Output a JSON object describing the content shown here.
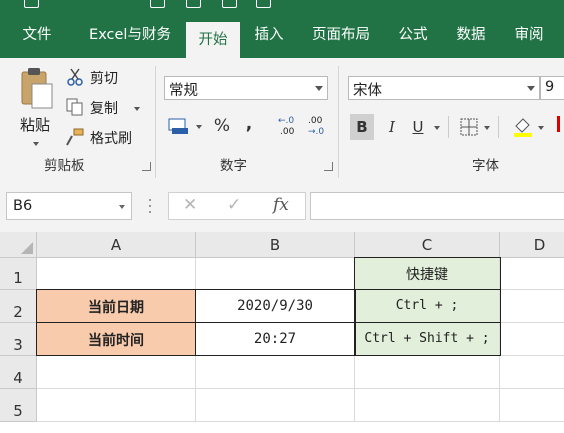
{
  "ribbon_tabs": [
    {
      "label": "文件"
    },
    {
      "label": "Excel与财务"
    },
    {
      "label": "开始"
    },
    {
      "label": "插入"
    },
    {
      "label": "页面布局"
    },
    {
      "label": "公式"
    },
    {
      "label": "数据"
    },
    {
      "label": "审阅"
    }
  ],
  "active_tab": "开始",
  "clipboard": {
    "paste_label": "粘贴",
    "cut_label": "剪切",
    "copy_label": "复制",
    "format_painter_label": "格式刷",
    "group_label": "剪贴板"
  },
  "number": {
    "format_value": "常规",
    "percent_symbol": "%",
    "comma_symbol": ",",
    "inc_decimal_top": "←.0",
    "inc_decimal_bottom": ".00",
    "dec_decimal_top": ".00",
    "dec_decimal_bottom": "→.0",
    "group_label": "数字"
  },
  "font": {
    "font_name": "宋体",
    "font_size": "9",
    "bold_label": "B",
    "italic_label": "I",
    "underline_label": "U",
    "group_label": "字体"
  },
  "formula_bar": {
    "name_box": "B6",
    "cancel_glyph": "✕",
    "enter_glyph": "✓",
    "fx_label": "fx",
    "content": ""
  },
  "columns": [
    "A",
    "B",
    "C",
    "D"
  ],
  "rows": [
    "1",
    "2",
    "3",
    "4",
    "5"
  ],
  "cells": {
    "C1": "快捷键",
    "A2": "当前日期",
    "B2": "2020/9/30",
    "C2": "Ctrl + ;",
    "A3": "当前时间",
    "B3": "20:27",
    "C3": "Ctrl + Shift + ;"
  },
  "colors": {
    "ribbon_green": "#217346",
    "header_fill": "#f8cbad",
    "shortcut_fill": "#e2efda"
  }
}
